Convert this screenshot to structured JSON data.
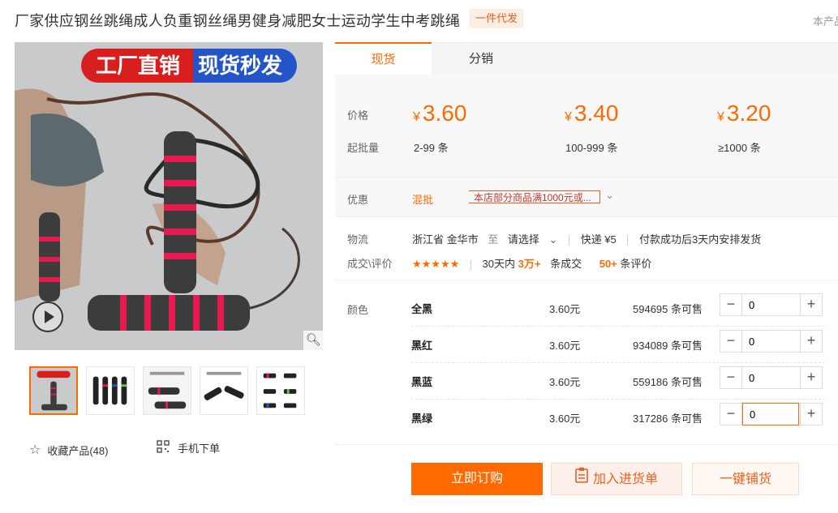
{
  "product": {
    "title": "厂家供应钢丝跳绳成人负重钢丝绳男健身减肥女士运动学生中考跳绳",
    "badge": "一件代发",
    "top_right_text": "本产品"
  },
  "gallery": {
    "banner_left": "工厂直销",
    "banner_right": "现货秒发",
    "thumbnail_count": 5,
    "favorite_label": "收藏产品(48)",
    "mobile_order_label": "手机下单"
  },
  "tabs": [
    {
      "label": "现货"
    },
    {
      "label": "分销"
    }
  ],
  "pricing": {
    "price_label": "价格",
    "qty_label": "起批量",
    "currency": "¥",
    "tiers": [
      {
        "price": "3.60",
        "qty": "2-99 条"
      },
      {
        "price": "3.40",
        "qty": "100-999 条"
      },
      {
        "price": "3.20",
        "qty": "≥1000 条"
      }
    ]
  },
  "promo": {
    "label": "优惠",
    "type": "混批",
    "tag_text": "本店部分商品满1000元或..."
  },
  "logistics": {
    "label": "物流",
    "origin": "浙江省 金华市",
    "to": "至",
    "destination": "请选择",
    "shipping": "快递 ¥5",
    "dispatch": "付款成功后3天内安排发货"
  },
  "reviews": {
    "label": "成交\\评价",
    "stars": "★★★★★",
    "sales_prefix": "30天内",
    "sales_count": "3万+",
    "sales_suffix": "条成交",
    "review_count": "50+",
    "review_suffix": "条评价"
  },
  "specs": {
    "label": "颜色",
    "items": [
      {
        "name": "全黑",
        "price": "3.60元",
        "stock": "594695 条可售",
        "qty": "0"
      },
      {
        "name": "黑红",
        "price": "3.60元",
        "stock": "934089 条可售",
        "qty": "0"
      },
      {
        "name": "黑蓝",
        "price": "3.60元",
        "stock": "559186 条可售",
        "qty": "0"
      },
      {
        "name": "黑绿",
        "price": "3.60元",
        "stock": "317286 条可售",
        "qty": "0"
      }
    ]
  },
  "actions": {
    "buy": "立即订购",
    "cart": "加入进货单",
    "distribute": "一键铺货"
  },
  "colors": {
    "accent": "#ff6a00",
    "rope_highlight": "#e8194f"
  }
}
